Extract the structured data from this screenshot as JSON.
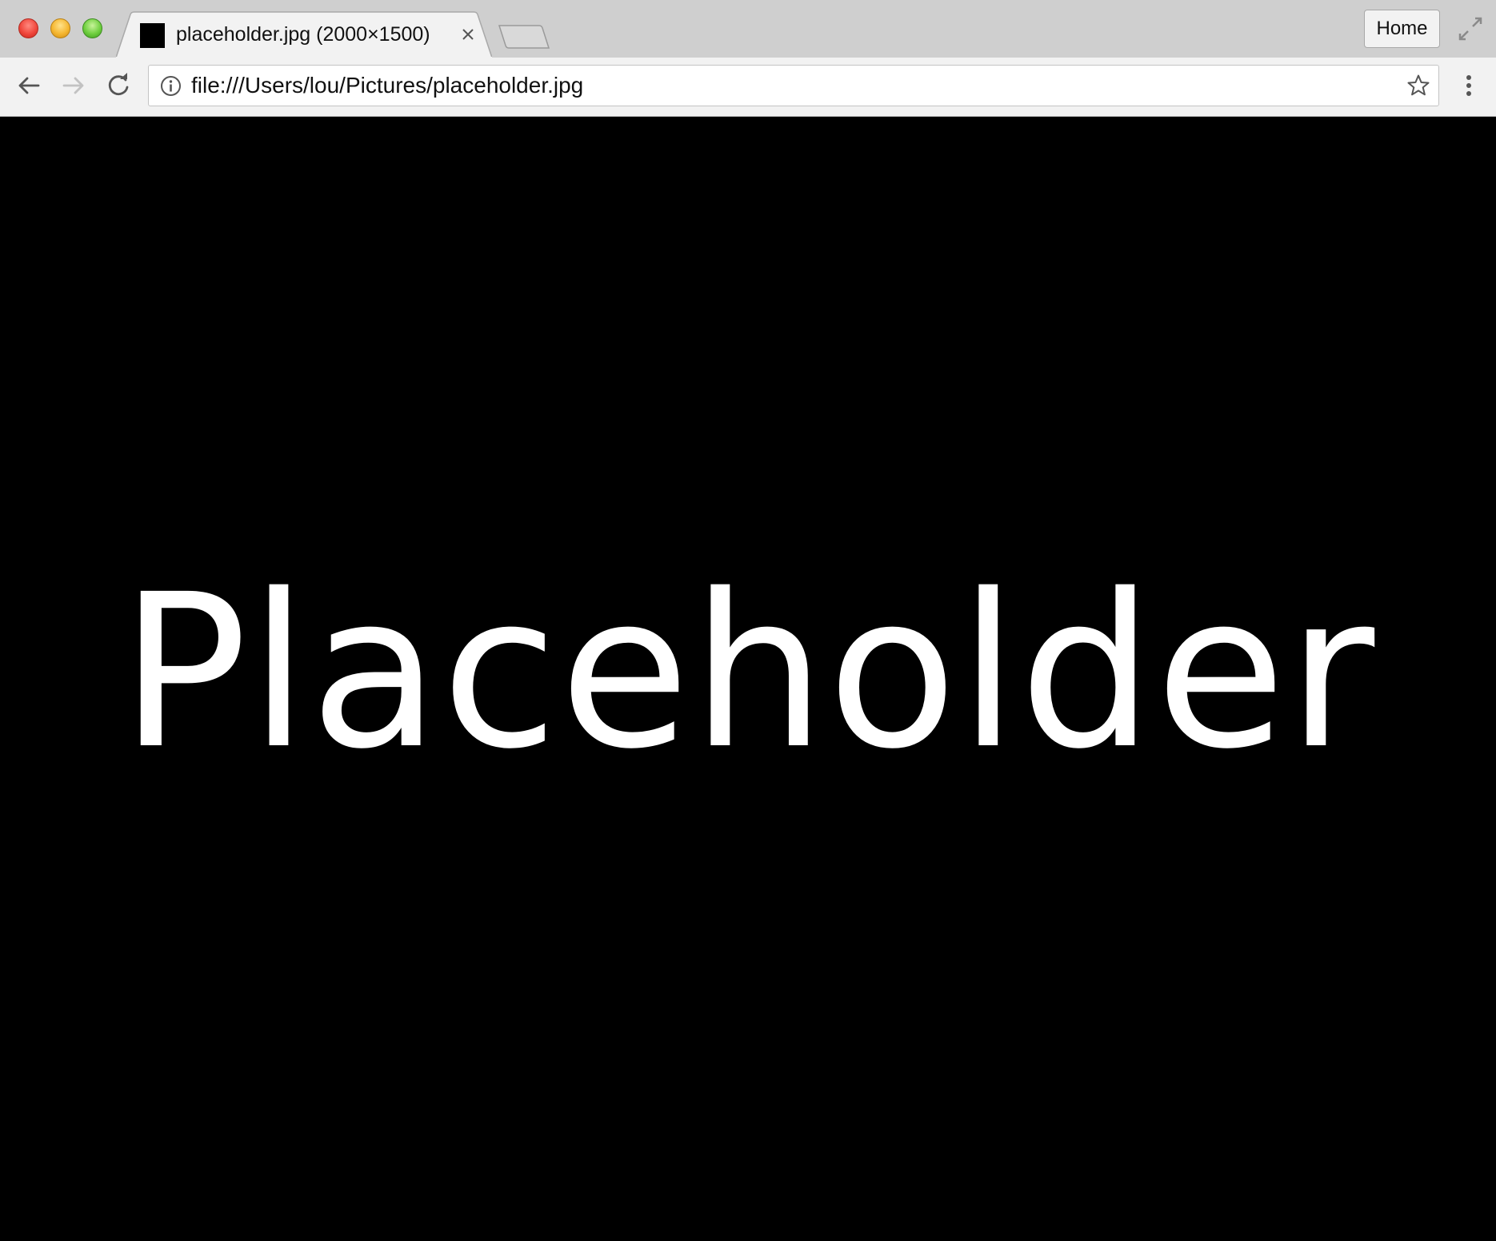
{
  "window": {
    "controls": [
      "close",
      "minimize",
      "zoom"
    ]
  },
  "tab": {
    "title": "placeholder.jpg (2000×1500)",
    "favicon": "image-thumbnail",
    "close_icon": "close-icon"
  },
  "toolbar": {
    "home_label": "Home",
    "back_icon": "arrow-left-icon",
    "forward_icon": "arrow-right-icon",
    "reload_icon": "reload-icon",
    "menu_icon": "vertical-dots-icon"
  },
  "omnibox": {
    "url": "file:///Users/lou/Pictures/placeholder.jpg",
    "info_icon": "info-icon",
    "bookmark_icon": "star-icon"
  },
  "content": {
    "image_text": "Placeholder",
    "background": "#000000",
    "text_color": "#ffffff"
  },
  "colors": {
    "tabstrip": "#cfcfcf",
    "toolbar": "#f2f2f2",
    "close": "#f0473c",
    "minimize": "#f5b731",
    "zoom": "#6fcf3f"
  }
}
